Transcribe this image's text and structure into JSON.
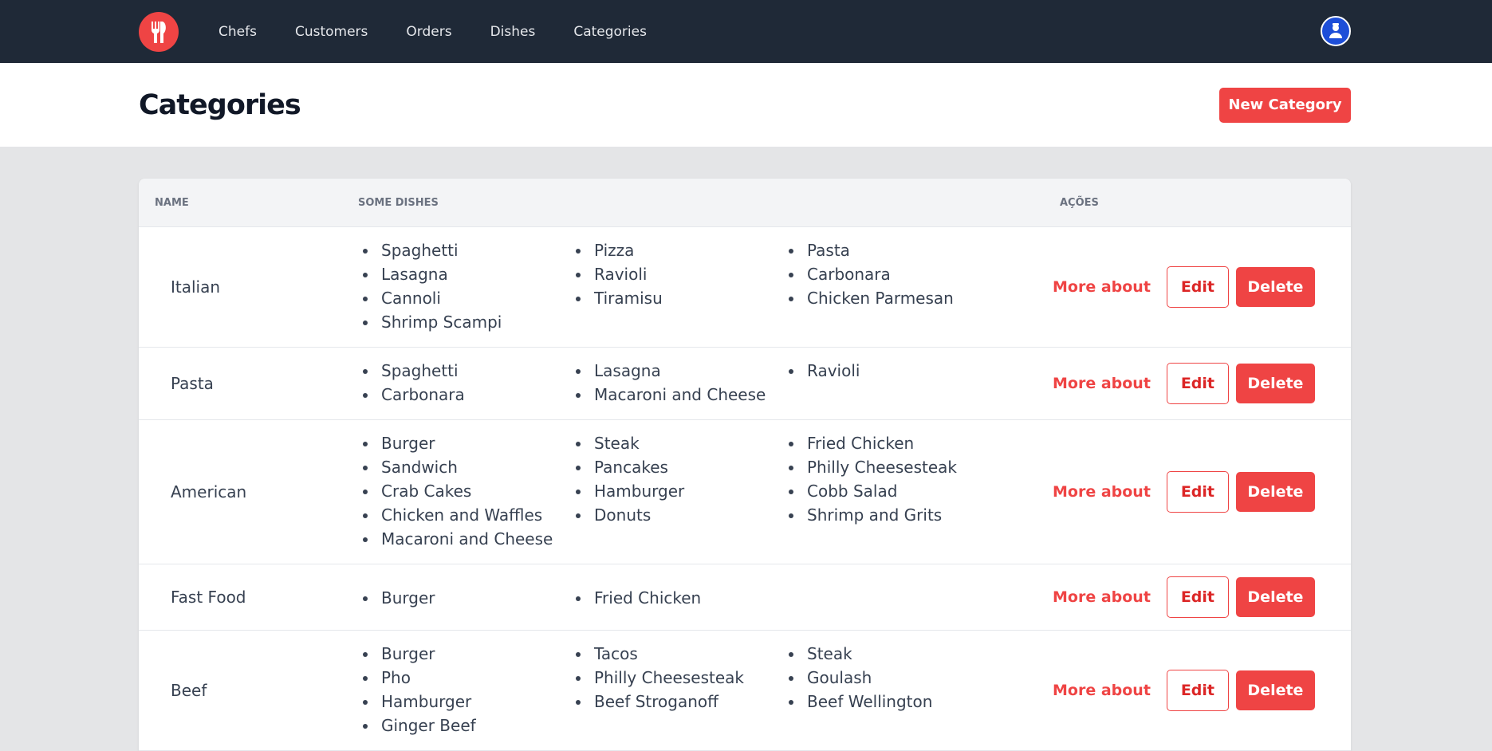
{
  "nav": {
    "items": [
      "Chefs",
      "Customers",
      "Orders",
      "Dishes",
      "Categories"
    ]
  },
  "header": {
    "title": "Categories",
    "new_button": "New Category"
  },
  "table": {
    "headers": {
      "name": "NAME",
      "dishes": "SOME DISHES",
      "actions": "AÇÕES"
    },
    "actions": {
      "more": "More about",
      "edit": "Edit",
      "delete": "Delete"
    },
    "rows": [
      {
        "name": "Italian",
        "cols": [
          [
            "Spaghetti",
            "Lasagna",
            "Cannoli",
            "Shrimp Scampi"
          ],
          [
            "Pizza",
            "Ravioli",
            "Tiramisu"
          ],
          [
            "Pasta",
            "Carbonara",
            "Chicken Parmesan"
          ]
        ]
      },
      {
        "name": "Pasta",
        "cols": [
          [
            "Spaghetti",
            "Carbonara"
          ],
          [
            "Lasagna",
            "Macaroni and Cheese"
          ],
          [
            "Ravioli"
          ]
        ]
      },
      {
        "name": "American",
        "cols": [
          [
            "Burger",
            "Sandwich",
            "Crab Cakes",
            "Chicken and Waffles",
            "Macaroni and Cheese"
          ],
          [
            "Steak",
            "Pancakes",
            "Hamburger",
            "Donuts"
          ],
          [
            "Fried Chicken",
            "Philly Cheesesteak",
            "Cobb Salad",
            "Shrimp and Grits"
          ]
        ]
      },
      {
        "name": "Fast Food",
        "cols": [
          [
            "Burger"
          ],
          [
            "Fried Chicken"
          ],
          []
        ]
      },
      {
        "name": "Beef",
        "cols": [
          [
            "Burger",
            "Pho",
            "Hamburger",
            "Ginger Beef"
          ],
          [
            "Tacos",
            "Philly Cheesesteak",
            "Beef Stroganoff"
          ],
          [
            "Steak",
            "Goulash",
            "Beef Wellington"
          ]
        ]
      }
    ]
  },
  "colors": {
    "nav_bg": "#1f2937",
    "accent": "#ef4444",
    "page_bg": "#e4e5e7"
  },
  "icons": {
    "logo": "fork-knife-icon",
    "avatar": "user-avatar"
  }
}
